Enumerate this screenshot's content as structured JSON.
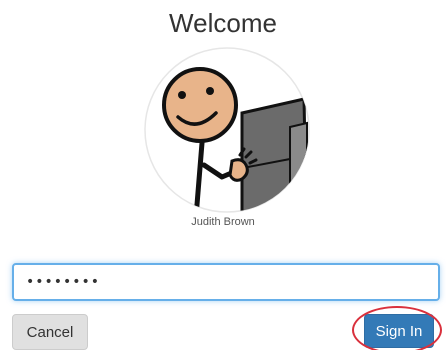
{
  "header": {
    "title": "Welcome"
  },
  "user": {
    "name": "Judith Brown",
    "avatar_icon": "stick-figure-at-computer-icon"
  },
  "password": {
    "value": "••••••••"
  },
  "actions": {
    "cancel_label": "Cancel",
    "signin_label": "Sign In"
  },
  "colors": {
    "primary": "#337ab7",
    "focus": "#66afe9",
    "highlight": "#d9303c",
    "skin": "#e8b48a"
  }
}
